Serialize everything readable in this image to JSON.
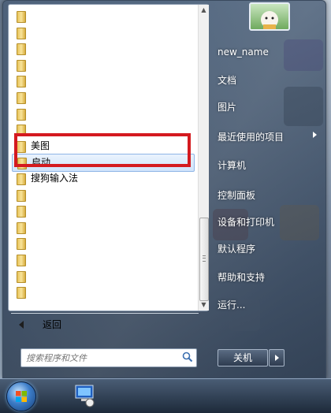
{
  "program_list": {
    "items": [
      {
        "label": "",
        "selected": false
      },
      {
        "label": "",
        "selected": false
      },
      {
        "label": "",
        "selected": false
      },
      {
        "label": "",
        "selected": false
      },
      {
        "label": "",
        "selected": false
      },
      {
        "label": "",
        "selected": false
      },
      {
        "label": "",
        "selected": false
      },
      {
        "label": "",
        "selected": false
      },
      {
        "label": "美图",
        "selected": false
      },
      {
        "label": "启动",
        "selected": true
      },
      {
        "label": "搜狗输入法",
        "selected": false
      },
      {
        "label": "",
        "selected": false
      },
      {
        "label": "",
        "selected": false
      },
      {
        "label": "",
        "selected": false
      },
      {
        "label": "",
        "selected": false
      },
      {
        "label": "",
        "selected": false
      },
      {
        "label": "",
        "selected": false
      },
      {
        "label": "",
        "selected": false
      }
    ]
  },
  "back": {
    "label": "返回"
  },
  "search": {
    "placeholder": "搜索程序和文件"
  },
  "right_pane": {
    "items": [
      {
        "label": "new_name"
      },
      {
        "label": "文档"
      },
      {
        "label": "图片"
      },
      {
        "label": "最近使用的项目",
        "has_submenu": true
      },
      {
        "label": "计算机"
      },
      {
        "label": "控制面板"
      },
      {
        "label": "设备和打印机"
      },
      {
        "label": "默认程序"
      },
      {
        "label": "帮助和支持"
      },
      {
        "label": "运行..."
      }
    ]
  },
  "shutdown": {
    "label": "关机"
  },
  "icons": {
    "search": "search-icon",
    "back": "back-arrow-icon",
    "folder": "folder-icon",
    "start": "windows-start-orb",
    "avatar": "user-avatar"
  },
  "colors": {
    "highlight_box": "#d41a1f",
    "selection": "#cfe3fb",
    "menu_glass": "#2f4159"
  }
}
